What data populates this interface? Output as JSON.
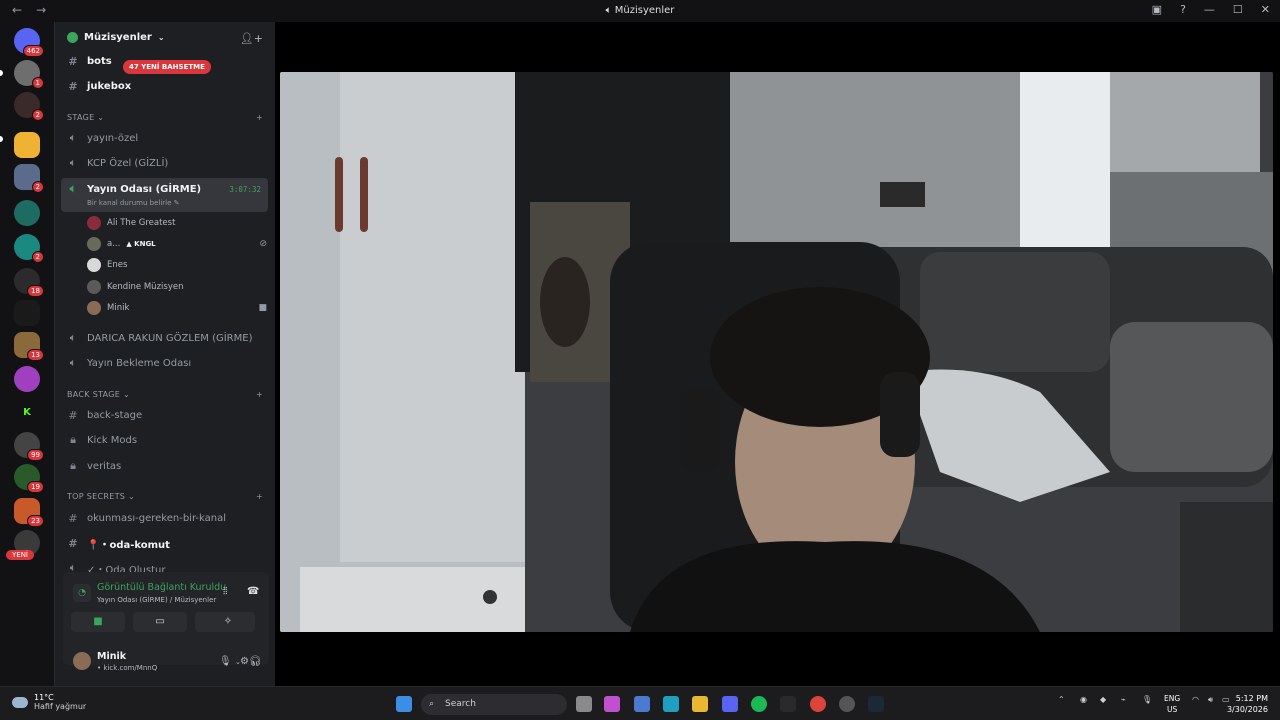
{
  "window": {
    "title": "Müzisyenler"
  },
  "server_badges": [
    "462",
    "1",
    "2",
    "2",
    "2",
    "18",
    "13",
    "99",
    "19",
    "23"
  ],
  "server_label": "YENİ",
  "guild": {
    "name": "Müzisyenler",
    "mention_badge": "47 YENİ BAHSETME",
    "channels_top": [
      {
        "name": "bots"
      },
      {
        "name": "jukebox"
      }
    ],
    "categories": [
      {
        "name": "STAGE"
      },
      {
        "name": "BACK STAGE"
      },
      {
        "name": "TOP SECRETS"
      }
    ],
    "stage_channels": [
      {
        "name": "yayın-özel"
      },
      {
        "name": "KCP Özel (GİZLİ)"
      },
      {
        "name": "Yayın Odası (GİRME)"
      },
      {
        "name": "DARICA RAKUN GÖZLEM (GİRME)"
      },
      {
        "name": "Yayın Bekleme Odası"
      }
    ],
    "active_voice": {
      "timer": "3:07:32",
      "status": "Bir kanal durumu belirle",
      "users": [
        {
          "name": "Ali The Greatest"
        },
        {
          "name": "a...",
          "tag": "KNGL"
        },
        {
          "name": "Enes"
        },
        {
          "name": "Kendine Müzisyen"
        },
        {
          "name": "Minik"
        }
      ]
    },
    "backstage_channels": [
      {
        "name": "back-stage"
      },
      {
        "name": "Kick Mods"
      },
      {
        "name": "veritas"
      }
    ],
    "secret_channels": [
      {
        "name": "okunması-gereken-bir-kanal"
      },
      {
        "name": "📍・oda-komut"
      },
      {
        "name": "✓・Oda Oluştur"
      }
    ]
  },
  "voice_panel": {
    "title": "Görüntülü Bağlantı Kuruldu",
    "subtitle": "Yayın Odası (GİRME) / Müzisyenler"
  },
  "user_bar": {
    "name": "Minik",
    "status": "• kick.com/MnnQ"
  },
  "taskbar": {
    "temperature": "11°C",
    "weather": "Hafif yağmur",
    "search": "Search",
    "lang_top": "ENG",
    "lang_bottom": "US",
    "time": "5:12 PM",
    "date": "3/30/2026"
  }
}
